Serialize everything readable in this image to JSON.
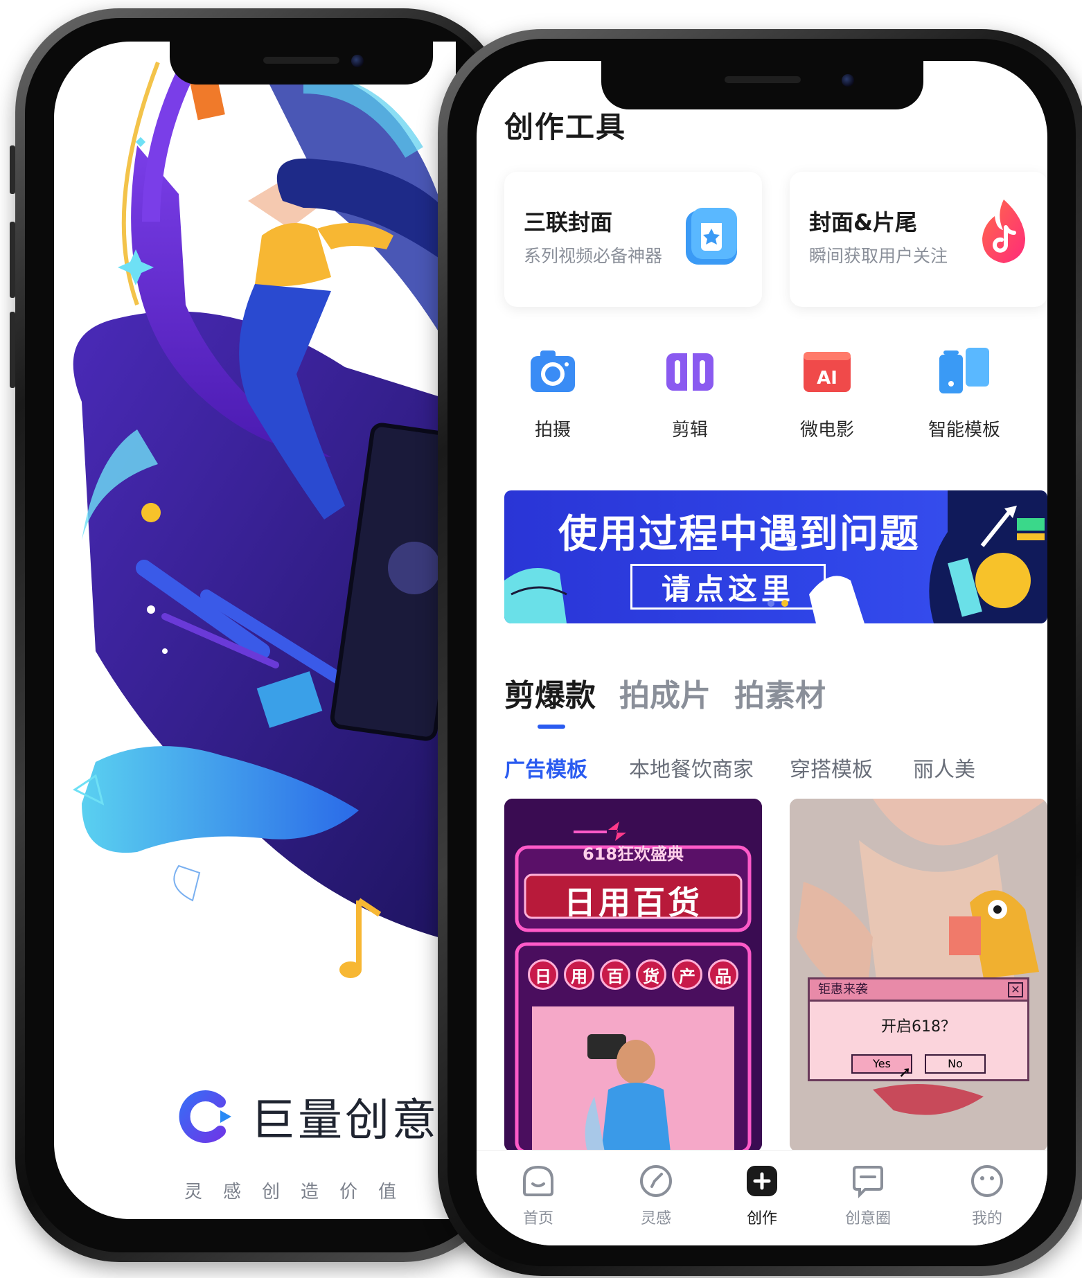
{
  "splash": {
    "brand_name": "巨量创意",
    "slogan_chars": [
      "灵",
      "感",
      "创",
      "造",
      "价",
      "值"
    ]
  },
  "app": {
    "page_title": "创作工具",
    "feature_cards": [
      {
        "title": "三联封面",
        "subtitle": "系列视频必备神器",
        "icon": "star-box-icon"
      },
      {
        "title": "封面&片尾",
        "subtitle": "瞬间获取用户关注",
        "icon": "douyin-flame-icon"
      }
    ],
    "tools": [
      {
        "label": "拍摄",
        "icon": "camera-icon"
      },
      {
        "label": "剪辑",
        "icon": "clip-edit-icon"
      },
      {
        "label": "微电影",
        "icon": "ai-film-icon"
      },
      {
        "label": "智能模板",
        "icon": "smart-template-icon"
      }
    ],
    "banner": {
      "headline": "使用过程中遇到问题",
      "button_label": "请点这里",
      "page_count": 2,
      "active_index": 1
    },
    "main_tabs": [
      "剪爆款",
      "拍成片",
      "拍素材"
    ],
    "main_tab_active": 0,
    "category_chips": [
      "广告模板",
      "本地餐饮商家",
      "穿搭模板",
      "丽人美"
    ],
    "chip_active": 0,
    "template_cards": [
      {
        "event_line": "618狂欢盛典",
        "headline": "日用百货",
        "product_line": [
          "日",
          "用",
          "百",
          "货",
          "产",
          "品"
        ]
      },
      {
        "popup_title": "钜惠来袭",
        "popup_question": "开启618？",
        "yes_label": "Yes",
        "no_label": "No"
      }
    ],
    "bottom_nav": [
      {
        "label": "首页",
        "icon": "home-icon"
      },
      {
        "label": "灵感",
        "icon": "compass-icon"
      },
      {
        "label": "创作",
        "icon": "plus-icon"
      },
      {
        "label": "创意圈",
        "icon": "chat-icon"
      },
      {
        "label": "我的",
        "icon": "face-icon"
      }
    ],
    "bottom_nav_active": 2
  },
  "colors": {
    "accent_blue": "#2a5bf0",
    "banner_blue": "#2f45e8",
    "text_primary": "#1a1a1a",
    "text_secondary": "#8a8f99"
  }
}
